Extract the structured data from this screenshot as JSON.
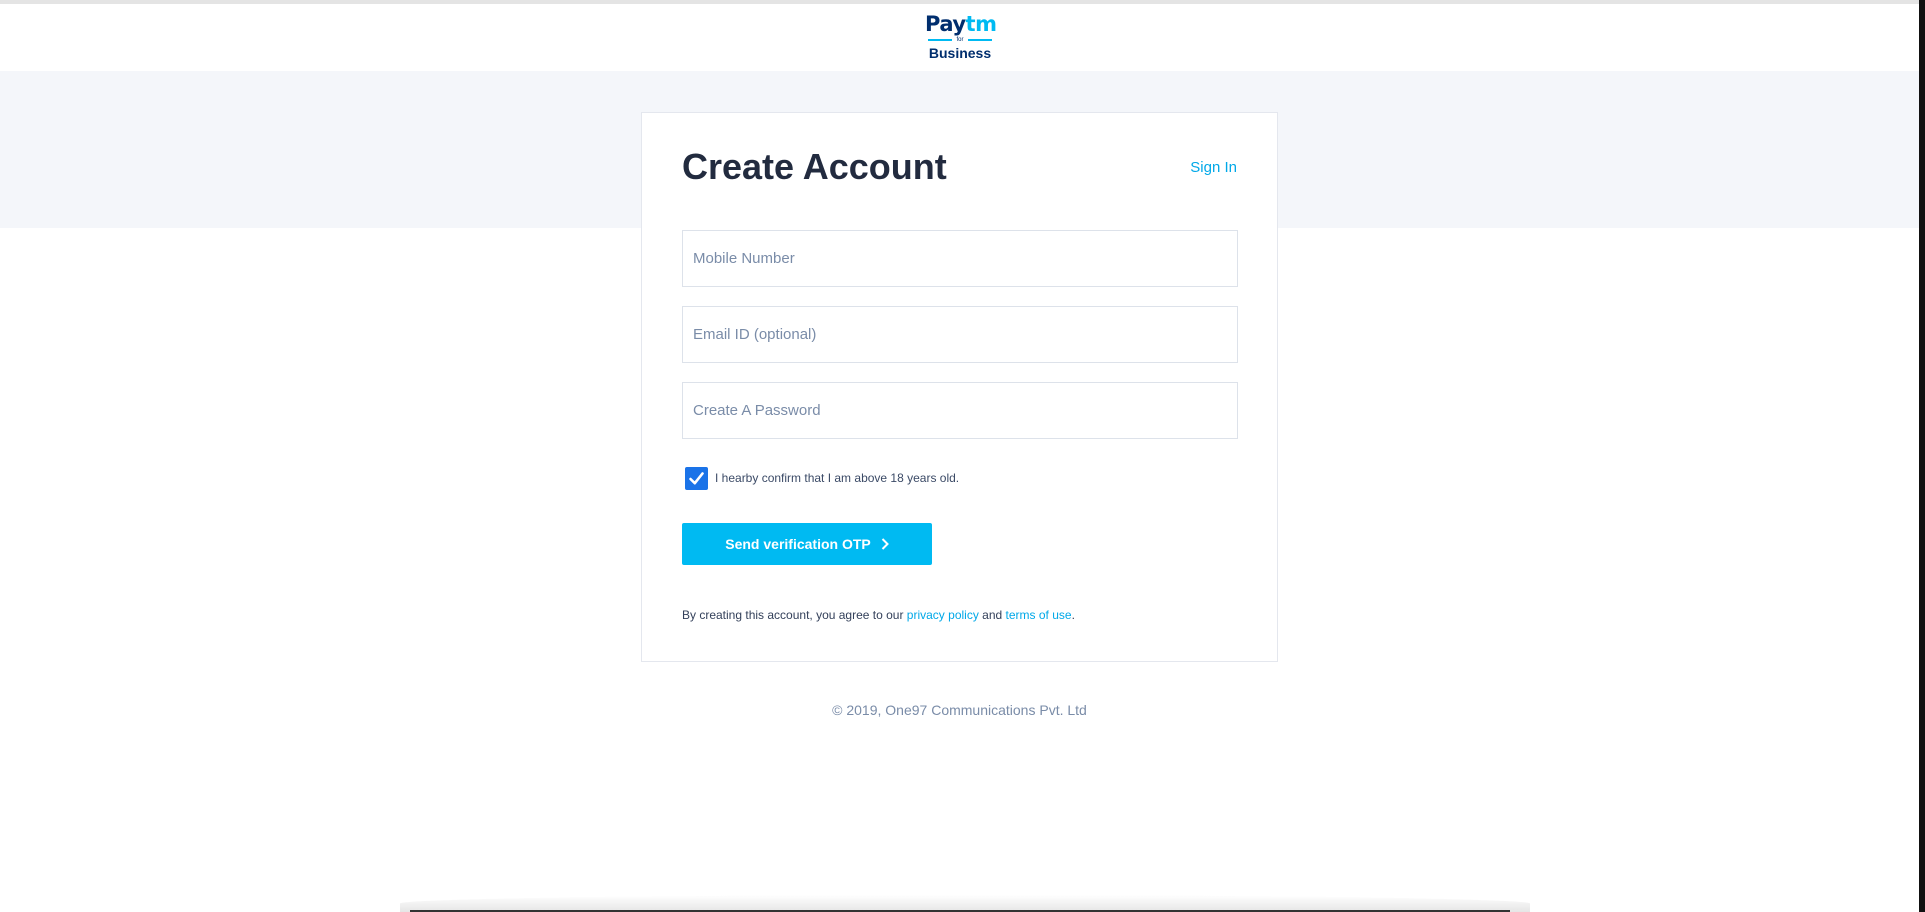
{
  "header": {
    "logo": {
      "pay": "Pay",
      "tm": "tm",
      "for": "for",
      "business": "Business"
    }
  },
  "form": {
    "title": "Create Account",
    "sign_in_label": "Sign In",
    "mobile": {
      "placeholder": "Mobile Number",
      "value": ""
    },
    "email": {
      "placeholder": "Email ID (optional)",
      "value": ""
    },
    "password": {
      "placeholder": "Create A Password",
      "value": ""
    },
    "age_confirm": {
      "label": "I hearby confirm that I am above 18 years old.",
      "checked": true
    },
    "submit_label": "Send verification OTP",
    "terms": {
      "prefix": "By creating this account, you agree to our ",
      "privacy_label": "privacy policy",
      "and": " and ",
      "terms_label": "terms of use",
      "suffix": "."
    }
  },
  "footer": {
    "copyright": "© 2019, One97 Communications Pvt. Ltd"
  },
  "colors": {
    "accent": "#00baf2",
    "link": "#00a8e8",
    "checkbox": "#1a73e8",
    "title": "#222b3f",
    "band": "#f4f6fa",
    "brand_dark": "#002e6e"
  },
  "icons": {
    "checkbox": "check-icon",
    "button": "chevron-right-icon"
  }
}
